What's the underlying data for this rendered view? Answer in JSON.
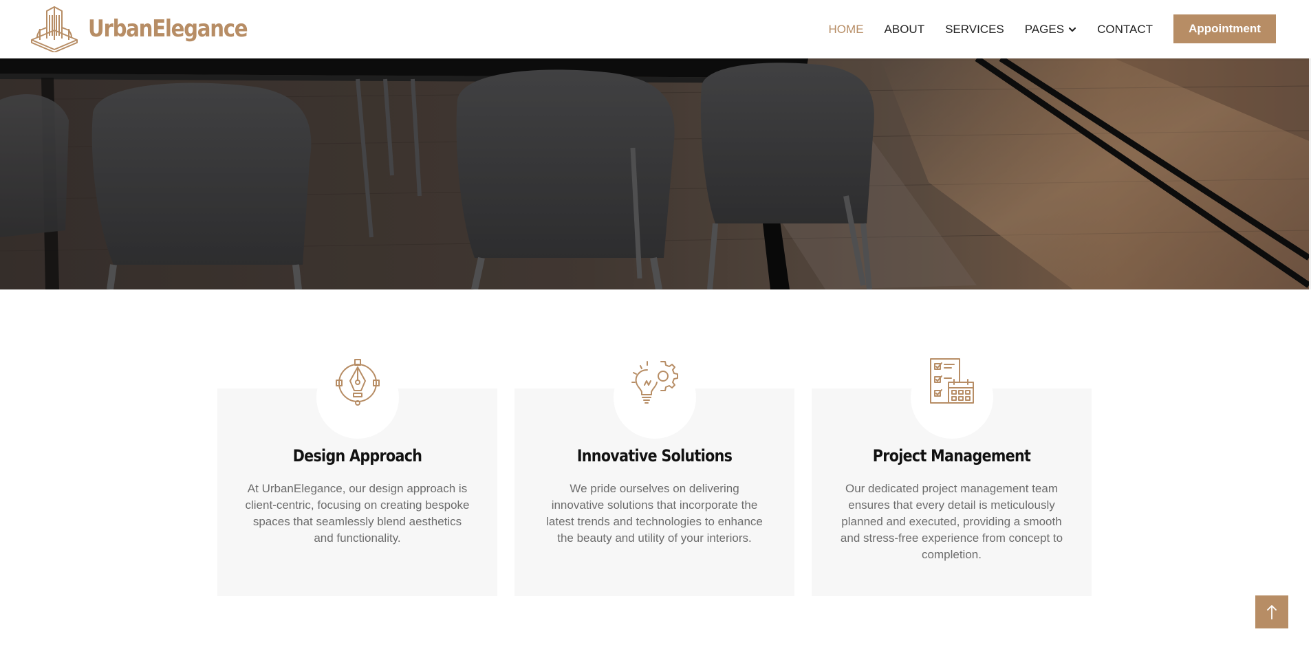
{
  "brand": {
    "name": "UrbanElegance",
    "logo_icon": "building-logo-icon"
  },
  "nav": {
    "items": [
      {
        "label": "HOME",
        "active": true
      },
      {
        "label": "ABOUT",
        "active": false
      },
      {
        "label": "SERVICES",
        "active": false
      },
      {
        "label": "PAGES",
        "active": false,
        "dropdown": true
      },
      {
        "label": "CONTACT",
        "active": false
      }
    ],
    "cta_label": "Appointment"
  },
  "features": [
    {
      "icon": "pen-tool-icon",
      "title": "Design Approach",
      "text": "At UrbanElegance, our design approach is client-centric, focusing on creating bespoke spaces that seamlessly blend aesthetics and functionality."
    },
    {
      "icon": "lightbulb-gear-icon",
      "title": "Innovative Solutions",
      "text": "We pride ourselves on delivering innovative solutions that incorporate the latest trends and technologies to enhance the beauty and utility of your interiors."
    },
    {
      "icon": "checklist-calendar-icon",
      "title": "Project Management",
      "text": "Our dedicated project management team ensures that every detail is meticulously planned and executed, providing a smooth and stress-free experience from concept to completion."
    }
  ],
  "colors": {
    "accent": "#B78D65",
    "card_bg": "#F7F7F7",
    "heading": "#111111",
    "body_text": "#6C6C6C"
  }
}
